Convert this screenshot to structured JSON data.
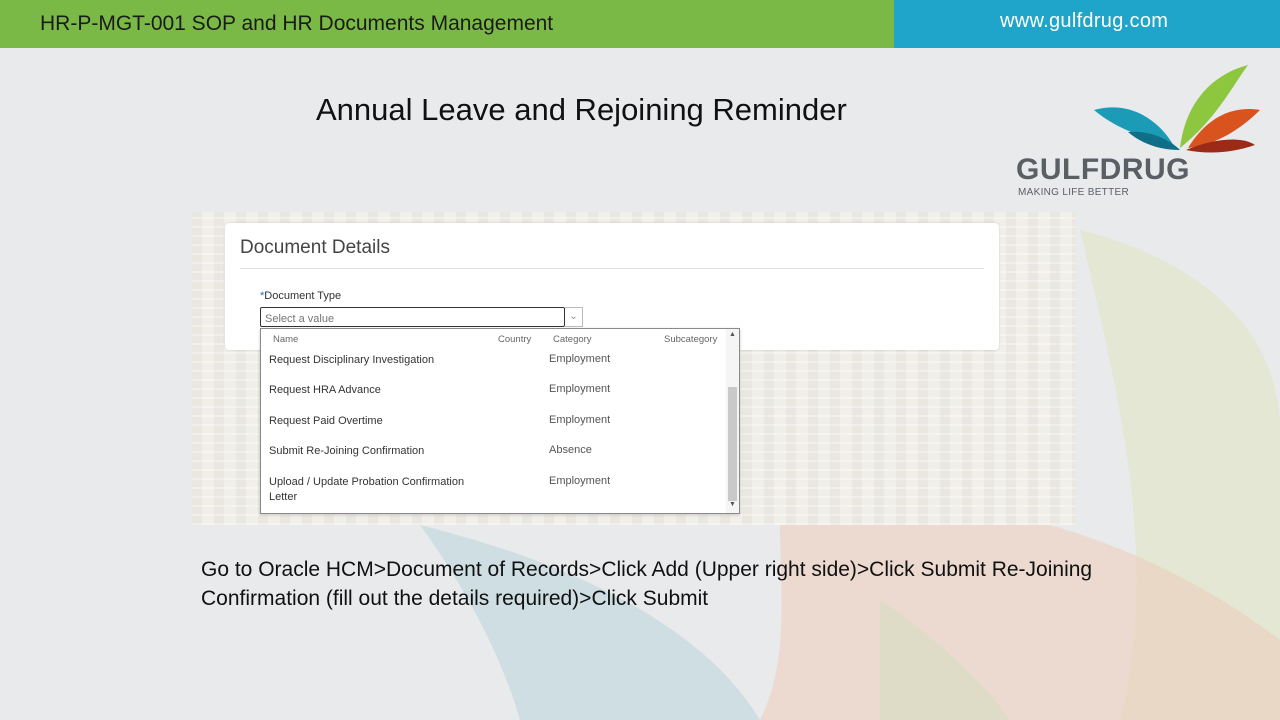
{
  "header": {
    "title": "HR-P-MGT-001 SOP and HR Documents Management",
    "website": "www.gulfdrug.com",
    "left_color": "#7ab945",
    "right_color": "#1fa5c9"
  },
  "slide": {
    "title": "Annual Leave and Rejoining Reminder"
  },
  "logo": {
    "name": "GULFDRUG",
    "tagline": "MAKING LIFE BETTER"
  },
  "document_details": {
    "title": "Document Details",
    "field_required_mark": "*",
    "field_label": "Document Type",
    "select_placeholder": "Select a value",
    "columns": {
      "name": "Name",
      "country": "Country",
      "category": "Category",
      "subcategory": "Subcategory"
    },
    "options": [
      {
        "name": "Request Disciplinary Investigation",
        "category": "Employment"
      },
      {
        "name": "Request HRA Advance",
        "category": "Employment"
      },
      {
        "name": "Request Paid Overtime",
        "category": "Employment"
      },
      {
        "name": "Submit Re-Joining Confirmation",
        "category": "Absence"
      },
      {
        "name": "Upload / Update Probation Confirmation Letter",
        "category": "Employment"
      }
    ]
  },
  "instructions": "Go to Oracle HCM>Document of Records>Click Add (Upper right side)>Click Submit Re-Joining Confirmation (fill out the details required)>Click Submit"
}
